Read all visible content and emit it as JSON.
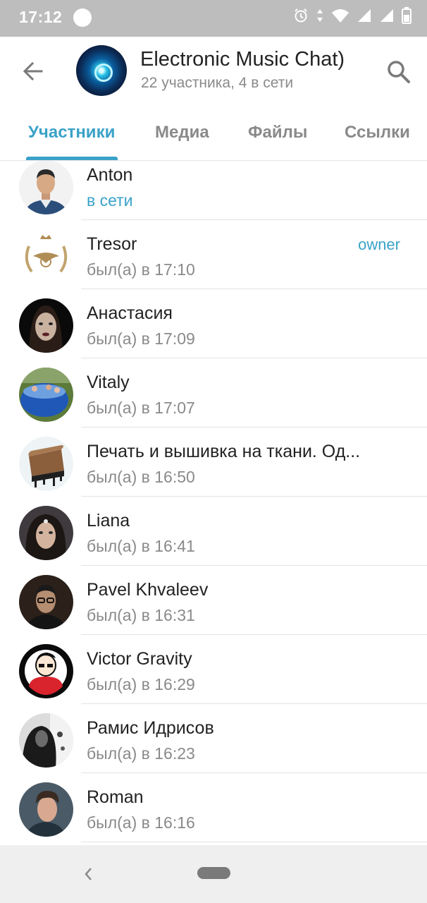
{
  "statusbar": {
    "time": "17:12"
  },
  "header": {
    "title": "Electronic Music Chat)",
    "subtitle": "22 участника, 4 в сети"
  },
  "tabs": [
    {
      "label": "Участники",
      "active": true
    },
    {
      "label": "Медиа"
    },
    {
      "label": "Файлы"
    },
    {
      "label": "Ссылки"
    }
  ],
  "members": [
    {
      "name": "Anton",
      "status": "в сети",
      "online": true
    },
    {
      "name": "Tresor",
      "status": "был(а) в 17:10",
      "role": "owner"
    },
    {
      "name": "Анастасия",
      "status": "был(а) в 17:09"
    },
    {
      "name": "Vitaly",
      "status": "был(а) в 17:07"
    },
    {
      "name": "Печать и вышивка на ткани. Од...",
      "status": "был(а) в 16:50"
    },
    {
      "name": "Liana",
      "status": "был(а) в 16:41"
    },
    {
      "name": "Pavel Khvaleev",
      "status": "был(а) в 16:31"
    },
    {
      "name": "Victor Gravity",
      "status": "был(а) в 16:29"
    },
    {
      "name": "Рамис Идрисов",
      "status": "был(а) в 16:23"
    },
    {
      "name": "Roman",
      "status": "был(а) в 16:16"
    }
  ],
  "colors": {
    "accent": "#3aa2c8",
    "statusbar": "#bdbdbd",
    "navbar": "#efefef"
  }
}
